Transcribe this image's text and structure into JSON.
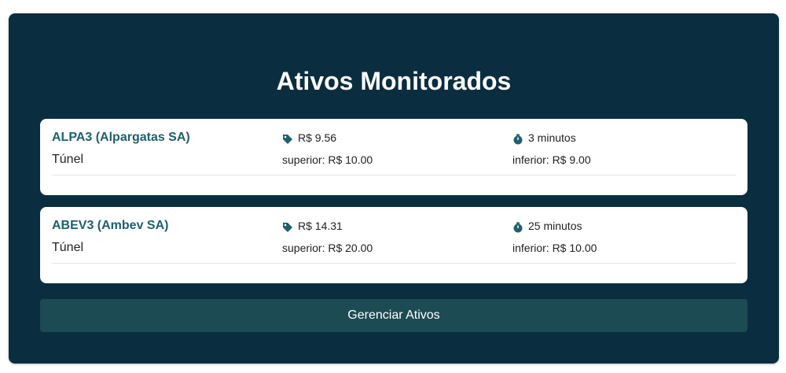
{
  "page": {
    "title": "Ativos Monitorados",
    "manage_button": "Gerenciar Ativos"
  },
  "colors": {
    "panel_bg": "#0a2e3f",
    "ticker": "#1f5f6e",
    "button_bg": "#1d4b54"
  },
  "assets": [
    {
      "ticker_name": "ALPA3 (Alpargatas SA)",
      "type": "Túnel",
      "price": "R$ 9.56",
      "upper": "superior: R$ 10.00",
      "interval": "3 minutos",
      "lower": "inferior: R$ 9.00",
      "price_icon": "tag-icon",
      "interval_icon": "stopwatch-icon"
    },
    {
      "ticker_name": "ABEV3 (Ambev SA)",
      "type": "Túnel",
      "price": "R$ 14.31",
      "upper": "superior: R$ 20.00",
      "interval": "25 minutos",
      "lower": "inferior: R$ 10.00",
      "price_icon": "tag-icon",
      "interval_icon": "stopwatch-icon"
    }
  ]
}
